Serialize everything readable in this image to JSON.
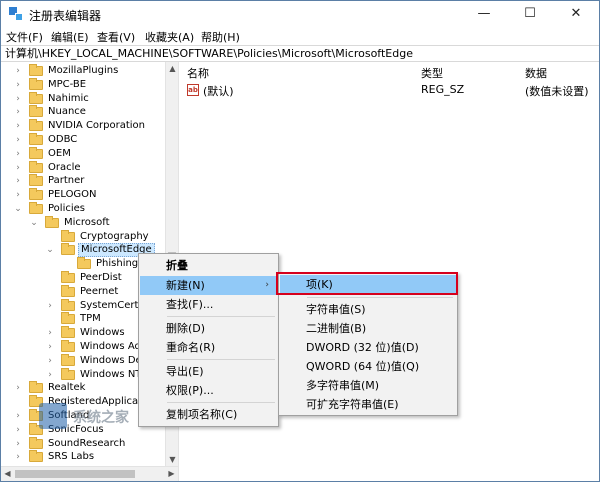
{
  "window": {
    "title": "注册表编辑器"
  },
  "titlebar": {
    "minimize": "—",
    "maximize": "☐",
    "close": "✕"
  },
  "menu": [
    "文件(F)",
    "编辑(E)",
    "查看(V)",
    "收藏夹(A)",
    "帮助(H)"
  ],
  "address": "计算机\\HKEY_LOCAL_MACHINE\\SOFTWARE\\Policies\\Microsoft\\MicrosoftEdge",
  "tree": [
    {
      "label": "MozillaPlugins",
      "expander": "›"
    },
    {
      "label": "MPC-BE",
      "expander": "›"
    },
    {
      "label": "Nahimic",
      "expander": "›"
    },
    {
      "label": "Nuance",
      "expander": "›"
    },
    {
      "label": "NVIDIA Corporation",
      "expander": "›"
    },
    {
      "label": "ODBC",
      "expander": "›"
    },
    {
      "label": "OEM",
      "expander": "›"
    },
    {
      "label": "Oracle",
      "expander": "›"
    },
    {
      "label": "Partner",
      "expander": "›"
    },
    {
      "label": "PELOGON",
      "expander": "›"
    },
    {
      "label": "Policies",
      "expander": "⌄"
    },
    {
      "label": "Microsoft",
      "expander": "⌄"
    },
    {
      "label": "Cryptography",
      "expander": ""
    },
    {
      "label": "MicrosoftEdge",
      "expander": "⌄",
      "selected": true
    },
    {
      "label": "PhishingFi",
      "expander": ""
    },
    {
      "label": "PeerDist",
      "expander": ""
    },
    {
      "label": "Peernet",
      "expander": ""
    },
    {
      "label": "SystemCertific",
      "expander": "›"
    },
    {
      "label": "TPM",
      "expander": ""
    },
    {
      "label": "Windows",
      "expander": "›"
    },
    {
      "label": "Windows Adv",
      "expander": "›"
    },
    {
      "label": "Windows Defe",
      "expander": "›"
    },
    {
      "label": "Windows NT",
      "expander": "›"
    },
    {
      "label": "Realtek",
      "expander": "›"
    },
    {
      "label": "RegisteredApplications",
      "expander": ""
    },
    {
      "label": "Softland",
      "expander": "›"
    },
    {
      "label": "SonicFocus",
      "expander": "›"
    },
    {
      "label": "SoundResearch",
      "expander": "›"
    },
    {
      "label": "SRS Labs",
      "expander": "›"
    }
  ],
  "list": {
    "headers": {
      "name": "名称",
      "type": "类型",
      "data": "数据"
    },
    "rows": [
      {
        "icon": "ab",
        "name": "(默认)",
        "type": "REG_SZ",
        "data": "(数值未设置)"
      }
    ]
  },
  "context_menu": {
    "items": [
      {
        "label": "折叠",
        "bold": true
      },
      {
        "label": "新建(N)",
        "submenu": "›",
        "highlighted": true
      },
      {
        "label": "查找(F)..."
      },
      {
        "label": "删除(D)"
      },
      {
        "label": "重命名(R)"
      },
      {
        "label": "导出(E)"
      },
      {
        "label": "权限(P)..."
      },
      {
        "label": "复制项名称(C)"
      }
    ]
  },
  "submenu": {
    "items": [
      {
        "label": "项(K)",
        "highlighted": true
      },
      {
        "label": "字符串值(S)"
      },
      {
        "label": "二进制值(B)"
      },
      {
        "label": "DWORD (32 位)值(D)"
      },
      {
        "label": "QWORD (64 位)值(Q)"
      },
      {
        "label": "多字符串值(M)"
      },
      {
        "label": "可扩充字符串值(E)"
      }
    ]
  },
  "watermark": {
    "text": "系统之家"
  },
  "colors": {
    "highlight": "#91c9f7",
    "callout": "#d6001c",
    "selection": "#cce8ff"
  }
}
